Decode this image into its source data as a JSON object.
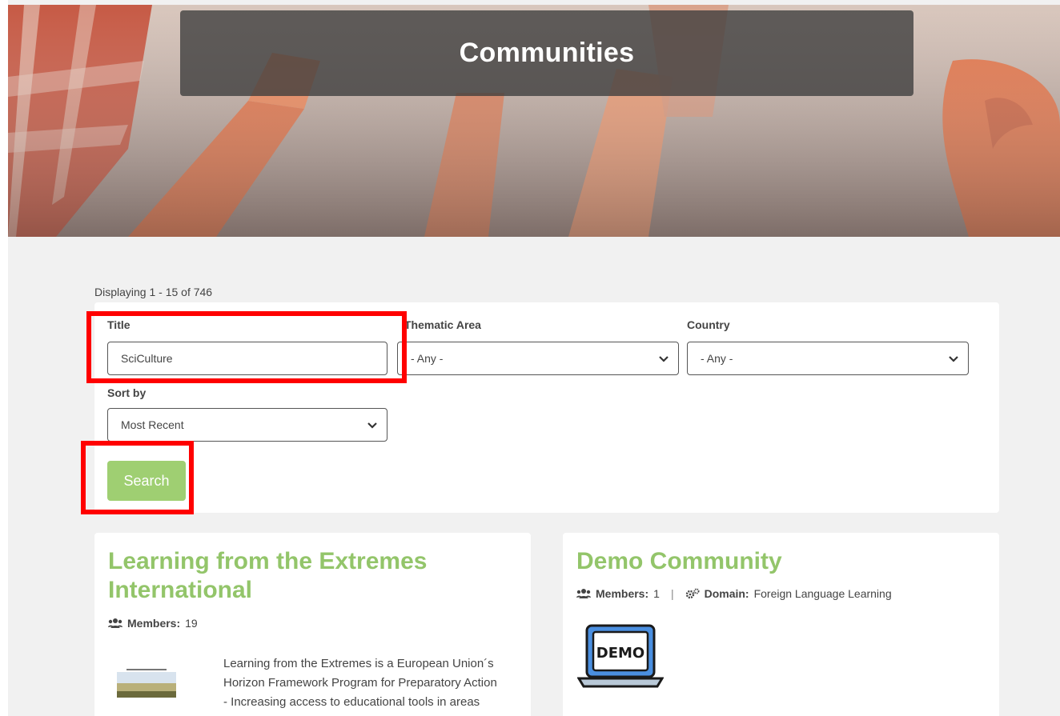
{
  "hero": {
    "title": "Communities"
  },
  "results": {
    "summary": "Displaying 1 - 15 of 746"
  },
  "filters": {
    "title_label": "Title",
    "title_value": "SciCulture",
    "thematic_label": "Thematic Area",
    "thematic_value": "- Any -",
    "country_label": "Country",
    "country_value": "- Any -",
    "sort_label": "Sort by",
    "sort_value": "Most Recent",
    "search_label": "Search"
  },
  "cards": [
    {
      "title_line1": "Learning from the Extremes",
      "title_line2": "International",
      "members_label": "Members:",
      "members_value": "19",
      "description_lines": [
        "Learning from the Extremes is a European Union´s",
        "Horizon Framework Program for Preparatory Action",
        "- Increasing access to educational tools in areas"
      ]
    },
    {
      "title": "Demo Community",
      "members_label": "Members:",
      "members_value": "1",
      "separator": "|",
      "domain_label": "Domain:",
      "domain_value": "Foreign Language Learning",
      "image_text": "DEMO"
    }
  ],
  "colors": {
    "accent_green": "#93c56a",
    "button_green": "#9fcf72",
    "highlight_red": "#ff0000"
  }
}
